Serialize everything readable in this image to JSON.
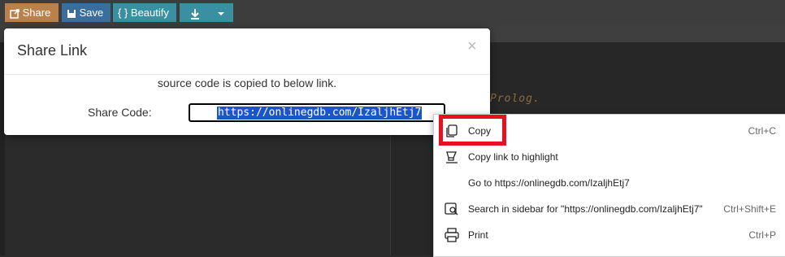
{
  "toolbar": {
    "share_label": "Share",
    "save_label": "Save",
    "beautify_label": "{ } Beautify"
  },
  "editor": {
    "comment_text": "Prolog."
  },
  "modal": {
    "title": "Share Link",
    "close_symbol": "×",
    "message": "source code is copied to below link.",
    "share_code_label": "Share Code:",
    "share_code_value": "https://onlinegdb.com/IzaljhEtj7"
  },
  "context_menu": {
    "items": [
      {
        "label": "Copy",
        "shortcut": "Ctrl+C",
        "icon": "copy-icon"
      },
      {
        "label": "Copy link to highlight",
        "shortcut": "",
        "icon": "copy-link-highlight-icon"
      },
      {
        "label": "Go to https://onlinegdb.com/IzaljhEtj7",
        "shortcut": "",
        "icon": ""
      },
      {
        "label": "Search in sidebar for \"https://onlinegdb.com/IzaljhEtj7\"",
        "shortcut": "Ctrl+Shift+E",
        "icon": "search-sidebar-icon"
      },
      {
        "label": "Print",
        "shortcut": "Ctrl+P",
        "icon": "print-icon"
      }
    ],
    "highlight_color": "#e8101f"
  }
}
